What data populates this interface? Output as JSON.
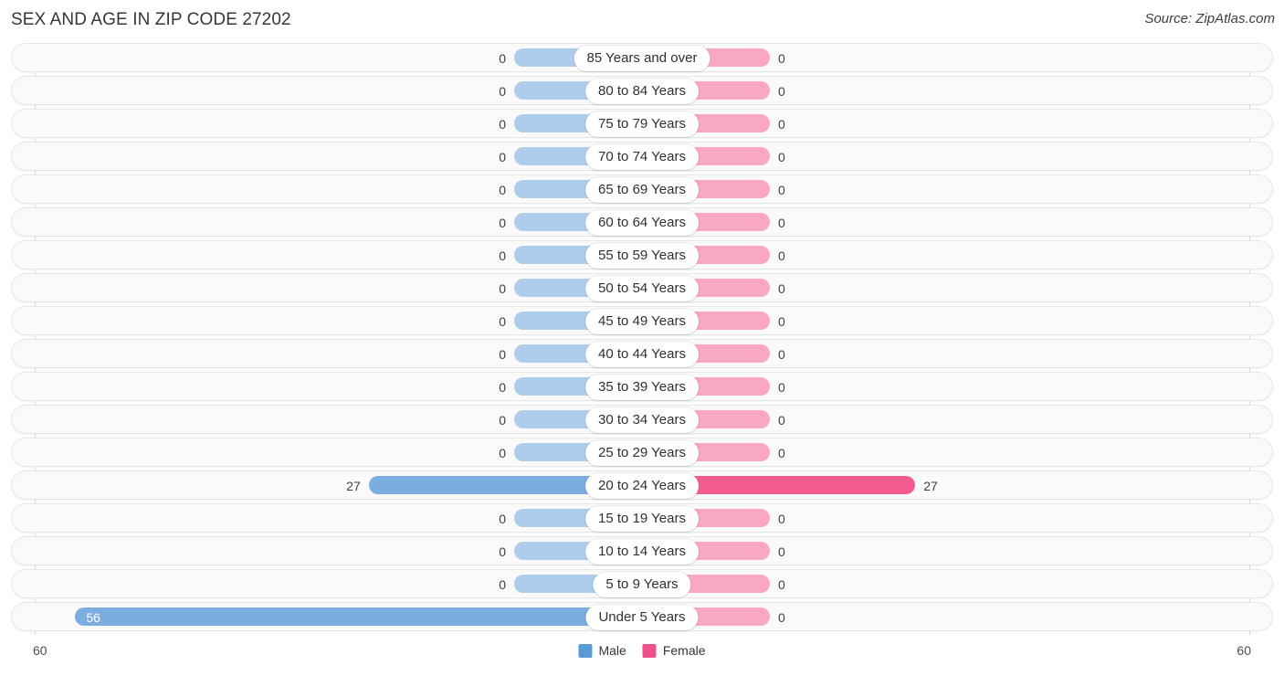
{
  "header": {
    "title": "SEX AND AGE IN ZIP CODE 27202",
    "source": "Source: ZipAtlas.com"
  },
  "legend": {
    "male_label": "Male",
    "female_label": "Female",
    "male_color": "#5B9BD5",
    "female_color": "#F0508A"
  },
  "axis": {
    "left_max": "60",
    "right_max": "60",
    "max_value": 60
  },
  "colors": {
    "male_bar": "#7BAEE0",
    "male_bar_zero": "#AECCEC",
    "female_bar": "#F45C91",
    "female_bar_zero": "#F9A8C2",
    "row_background": "#FAFAFA",
    "row_border": "#E6E6E6"
  },
  "chart_data": {
    "type": "bar",
    "title": "SEX AND AGE IN ZIP CODE 27202",
    "subtitle": "Source: ZipAtlas.com",
    "orientation": "horizontal",
    "layout": "population-pyramid",
    "xlabel": "",
    "ylabel": "",
    "xlim": [
      60,
      60
    ],
    "grid": false,
    "legend_position": "bottom-center",
    "categories": [
      "85 Years and over",
      "80 to 84 Years",
      "75 to 79 Years",
      "70 to 74 Years",
      "65 to 69 Years",
      "60 to 64 Years",
      "55 to 59 Years",
      "50 to 54 Years",
      "45 to 49 Years",
      "40 to 44 Years",
      "35 to 39 Years",
      "30 to 34 Years",
      "25 to 29 Years",
      "20 to 24 Years",
      "15 to 19 Years",
      "10 to 14 Years",
      "5 to 9 Years",
      "Under 5 Years"
    ],
    "series": [
      {
        "name": "Male",
        "values": [
          0,
          0,
          0,
          0,
          0,
          0,
          0,
          0,
          0,
          0,
          0,
          0,
          0,
          27,
          0,
          0,
          0,
          56
        ]
      },
      {
        "name": "Female",
        "values": [
          0,
          0,
          0,
          0,
          0,
          0,
          0,
          0,
          0,
          0,
          0,
          0,
          0,
          27,
          0,
          0,
          0,
          0
        ]
      }
    ]
  },
  "rows": [
    {
      "label": "85 Years and over",
      "male": "0",
      "female": "0"
    },
    {
      "label": "80 to 84 Years",
      "male": "0",
      "female": "0"
    },
    {
      "label": "75 to 79 Years",
      "male": "0",
      "female": "0"
    },
    {
      "label": "70 to 74 Years",
      "male": "0",
      "female": "0"
    },
    {
      "label": "65 to 69 Years",
      "male": "0",
      "female": "0"
    },
    {
      "label": "60 to 64 Years",
      "male": "0",
      "female": "0"
    },
    {
      "label": "55 to 59 Years",
      "male": "0",
      "female": "0"
    },
    {
      "label": "50 to 54 Years",
      "male": "0",
      "female": "0"
    },
    {
      "label": "45 to 49 Years",
      "male": "0",
      "female": "0"
    },
    {
      "label": "40 to 44 Years",
      "male": "0",
      "female": "0"
    },
    {
      "label": "35 to 39 Years",
      "male": "0",
      "female": "0"
    },
    {
      "label": "30 to 34 Years",
      "male": "0",
      "female": "0"
    },
    {
      "label": "25 to 29 Years",
      "male": "0",
      "female": "0"
    },
    {
      "label": "20 to 24 Years",
      "male": "27",
      "female": "27"
    },
    {
      "label": "15 to 19 Years",
      "male": "0",
      "female": "0"
    },
    {
      "label": "10 to 14 Years",
      "male": "0",
      "female": "0"
    },
    {
      "label": "5 to 9 Years",
      "male": "0",
      "female": "0"
    },
    {
      "label": "Under 5 Years",
      "male": "56",
      "female": "0"
    }
  ]
}
